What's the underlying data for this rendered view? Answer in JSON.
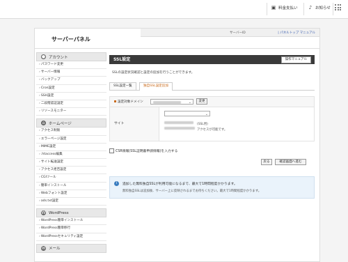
{
  "topbar": {
    "items": [
      {
        "label": "料金支払い",
        "icon": "wallet-icon"
      },
      {
        "label": "お知らせ",
        "icon": "bell-icon"
      }
    ]
  },
  "header": {
    "title": "サーバーパネル",
    "server_id_label": "サーバーID",
    "links": "| パネルトップ マニュアル"
  },
  "sidebar": {
    "sections": [
      {
        "title": "アカウント",
        "icon": "user-icon",
        "items": [
          "パスワード変更",
          "サーバー情報",
          "バックアップ",
          "Cron設定",
          "SSH設定",
          "二段階認証設定",
          "リソースモニター"
        ]
      },
      {
        "title": "ホームページ",
        "icon": "home-icon",
        "items": [
          "アクセス制限",
          "エラーページ設定",
          "MIME設定",
          ".htaccess編集",
          "サイト転送設定",
          "アクセス拒否設定",
          "CGIツール",
          "簡単インストール",
          "Webフォント設定",
          "ads.txt設定"
        ]
      },
      {
        "title": "WordPress",
        "icon": "wordpress-icon",
        "items": [
          "WordPress簡単インストール",
          "WordPress簡単移行",
          "WordPressセキュリティ設定"
        ]
      },
      {
        "title": "メール",
        "icon": "mail-icon",
        "items": []
      }
    ]
  },
  "main": {
    "title": "SSL設定",
    "manual_button": "操作マニュアル",
    "description": "SSLの設定状況確認と設定の追加を行うことができます。",
    "tabs": [
      "SSL設定一覧",
      "独自SSL設定追加"
    ],
    "active_tab": 1,
    "domain_label": "設定対象ドメイン",
    "change_button": "変更",
    "site_label": "サイト",
    "site_note1": "(SSL用)",
    "site_note2": "アクセスが可能です。",
    "csr_label": "CSR情報(SSL証明書申請情報)を入力する",
    "back_button": "戻る",
    "confirm_button": "確認画面へ進む",
    "info_title": "追加した無料独自SSLが利用可能になるまで、最大で1時間程度かかります。",
    "info_text": "無料独自SSLは追加後、サーバー上に反映されるまでお待ちください。最大で1時間程度かかります。"
  },
  "colors": {
    "accent": "#c96a1a",
    "header_bg": "#3a3a3a",
    "info_bg": "#eaf3fb",
    "link": "#3b5fb0"
  }
}
